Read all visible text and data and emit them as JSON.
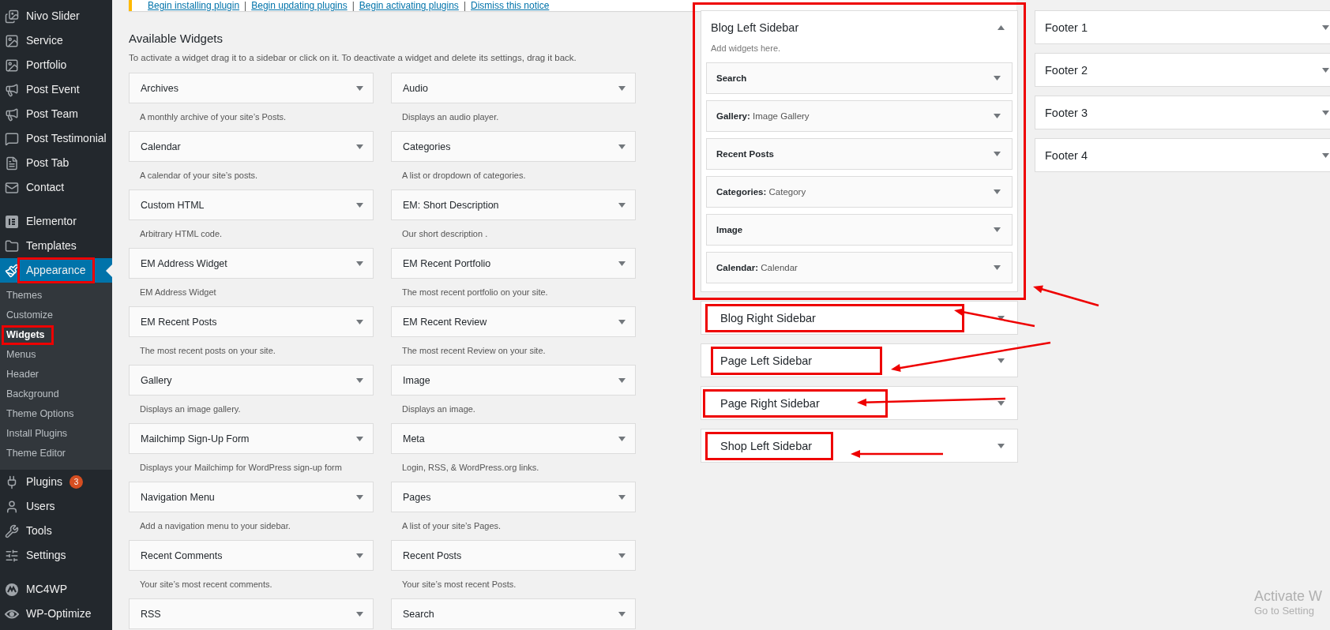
{
  "admin_menu": {
    "groups": [
      {
        "items": [
          {
            "label": "Nivo Slider",
            "selected": false,
            "highlighted": false
          },
          {
            "label": "Service",
            "selected": false,
            "highlighted": false
          },
          {
            "label": "Portfolio",
            "selected": false,
            "highlighted": false
          },
          {
            "label": "Post Event",
            "selected": false,
            "highlighted": false
          },
          {
            "label": "Post Team",
            "selected": false,
            "highlighted": false
          },
          {
            "label": "Post Testimonial",
            "selected": false,
            "highlighted": false
          },
          {
            "label": "Post Tab",
            "selected": false,
            "highlighted": false
          },
          {
            "label": "Contact",
            "selected": false,
            "highlighted": false
          }
        ]
      },
      {
        "items": [
          {
            "label": "Elementor",
            "selected": false,
            "highlighted": false
          },
          {
            "label": "Templates",
            "selected": false,
            "highlighted": false
          },
          {
            "label": "Appearance",
            "selected": true,
            "highlighted": true,
            "submenu": [
              {
                "label": "Themes",
                "selected": false,
                "highlighted": false
              },
              {
                "label": "Customize",
                "selected": false,
                "highlighted": false
              },
              {
                "label": "Widgets",
                "selected": true,
                "highlighted": true
              },
              {
                "label": "Menus",
                "selected": false,
                "highlighted": false
              },
              {
                "label": "Header",
                "selected": false,
                "highlighted": false
              },
              {
                "label": "Background",
                "selected": false,
                "highlighted": false
              },
              {
                "label": "Theme Options",
                "selected": false,
                "highlighted": false
              },
              {
                "label": "Install Plugins",
                "selected": false,
                "highlighted": false
              },
              {
                "label": "Theme Editor",
                "selected": false,
                "highlighted": false
              }
            ]
          },
          {
            "label": "Plugins",
            "selected": false,
            "highlighted": false,
            "badge": "3"
          },
          {
            "label": "Users",
            "selected": false,
            "highlighted": false
          },
          {
            "label": "Tools",
            "selected": false,
            "highlighted": false
          },
          {
            "label": "Settings",
            "selected": false,
            "highlighted": false
          }
        ]
      },
      {
        "items": [
          {
            "label": "MC4WP",
            "selected": false,
            "highlighted": false
          },
          {
            "label": "WP-Optimize",
            "selected": false,
            "highlighted": false
          }
        ]
      }
    ]
  },
  "notice": {
    "separator": "|",
    "links": [
      "Begin installing plugin",
      "Begin updating plugins",
      "Begin activating plugins",
      "Dismiss this notice"
    ]
  },
  "available_widgets": {
    "title": "Available Widgets",
    "description": "To activate a widget drag it to a sidebar or click on it. To deactivate a widget and delete its settings, drag it back.",
    "widgets": [
      {
        "name": "Archives",
        "description": "A monthly archive of your site’s Posts."
      },
      {
        "name": "Audio",
        "description": "Displays an audio player."
      },
      {
        "name": "Calendar",
        "description": "A calendar of your site’s posts."
      },
      {
        "name": "Categories",
        "description": "A list or dropdown of categories."
      },
      {
        "name": "Custom HTML",
        "description": "Arbitrary HTML code."
      },
      {
        "name": "EM: Short Description",
        "description": "Our short description ."
      },
      {
        "name": "EM Address Widget",
        "description": "EM Address Widget"
      },
      {
        "name": "EM Recent Portfolio",
        "description": "The most recent portfolio on your site."
      },
      {
        "name": "EM Recent Posts",
        "description": "The most recent posts on your site."
      },
      {
        "name": "EM Recent Review",
        "description": "The most recent Review on your site."
      },
      {
        "name": "Gallery",
        "description": "Displays an image gallery."
      },
      {
        "name": "Image",
        "description": "Displays an image."
      },
      {
        "name": "Mailchimp Sign-Up Form",
        "description": "Displays your Mailchimp for WordPress sign-up form"
      },
      {
        "name": "Meta",
        "description": "Login, RSS, & WordPress.org links."
      },
      {
        "name": "Navigation Menu",
        "description": "Add a navigation menu to your sidebar."
      },
      {
        "name": "Pages",
        "description": "A list of your site’s Pages."
      },
      {
        "name": "Recent Comments",
        "description": "Your site’s most recent comments."
      },
      {
        "name": "Recent Posts",
        "description": "Your site’s most recent Posts."
      },
      {
        "name": "RSS"
      },
      {
        "name": "Search"
      }
    ]
  },
  "sidebar_columns": [
    {
      "sidebars": [
        {
          "title": "Blog Left Sidebar",
          "expanded": true,
          "highlighted": true,
          "description": "Add widgets here.",
          "widgets": [
            {
              "name": "Search"
            },
            {
              "name": "Gallery:",
              "title": "Image Gallery"
            },
            {
              "name": "Recent Posts"
            },
            {
              "name": "Categories:",
              "title": "Category"
            },
            {
              "name": "Image"
            },
            {
              "name": "Calendar:",
              "title": "Calendar"
            }
          ]
        },
        {
          "title": "Blog Right Sidebar",
          "expanded": false,
          "highlighted": true
        },
        {
          "title": "Page Left Sidebar",
          "expanded": false,
          "highlighted": true
        },
        {
          "title": "Page Right Sidebar",
          "expanded": false,
          "highlighted": true
        },
        {
          "title": "Shop Left Sidebar",
          "expanded": false,
          "highlighted": true
        }
      ]
    },
    {
      "sidebars": [
        {
          "title": "Footer 1",
          "expanded": false,
          "highlighted": false
        },
        {
          "title": "Footer 2",
          "expanded": false,
          "highlighted": false
        },
        {
          "title": "Footer 3",
          "expanded": false,
          "highlighted": false
        },
        {
          "title": "Footer 4",
          "expanded": false,
          "highlighted": false
        }
      ]
    }
  ],
  "system_watermark": [
    "Activate W",
    "Go to Setting"
  ]
}
